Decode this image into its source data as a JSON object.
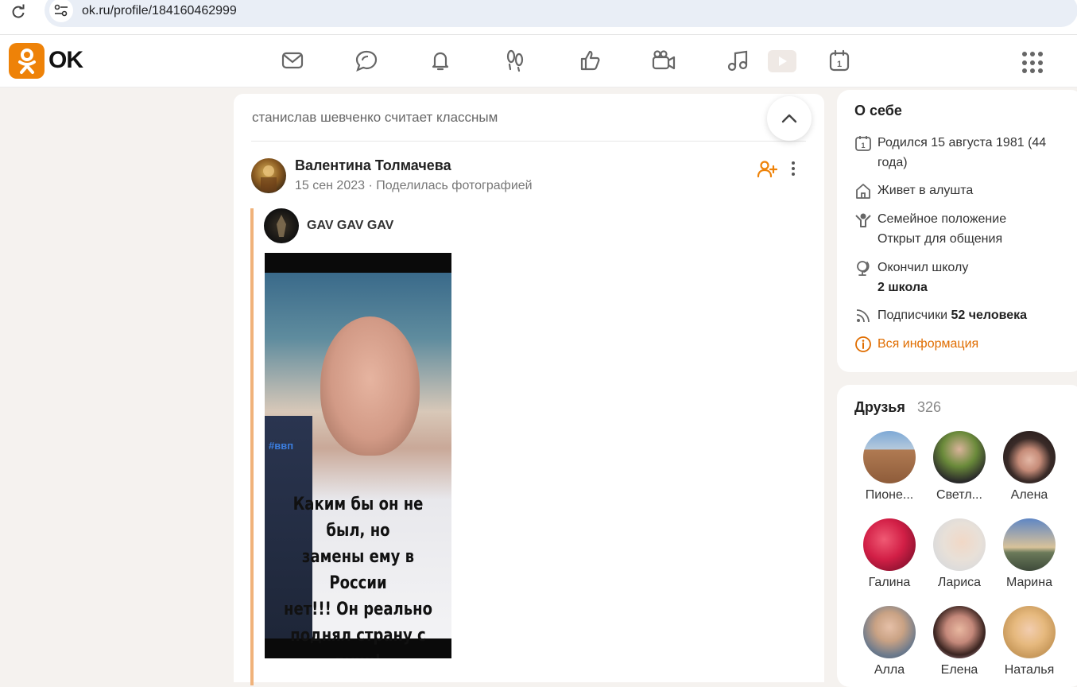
{
  "browser": {
    "url": "ok.ru/profile/184160462999"
  },
  "header": {
    "logo_text": "OK",
    "brand_color": "#ee8208",
    "nav_icons": [
      "messages-icon",
      "discussions-icon",
      "notifications-icon",
      "guests-icon",
      "reactions-icon",
      "video-icon",
      "music-icon",
      "video-player-icon",
      "calendar-icon"
    ]
  },
  "feed": {
    "liked_by": "станислав шевченко считает классным",
    "post": {
      "author": "Валентина Толмачева",
      "date": "15 сен 2023",
      "separator": "·",
      "action": "Поделилась фотографией",
      "repost": {
        "group_name": "GAV GAV GAV",
        "photo_hashtag": "#ввп",
        "photo_caption": "Каким бы он не был, но\nзамены ему в России\nнет!!! Он реально\nподнял страну с руин!"
      }
    }
  },
  "about": {
    "title": "О себе",
    "birth": "Родился 15 августа 1981 (44 года)",
    "lives": "Живет в алушта",
    "family_label": "Семейное положение",
    "family_value": "Открыт для общения",
    "school_label": "Окончил школу",
    "school_value": "2 школа",
    "subscribers_label": "Подписчики",
    "subscribers_value": "52 человека",
    "all_info": "Вся информация",
    "link_color": "#e06d00"
  },
  "friends": {
    "title": "Друзья",
    "count": "326",
    "items": [
      {
        "name": "Пионе..."
      },
      {
        "name": "Светл..."
      },
      {
        "name": "Алена"
      },
      {
        "name": "Галина"
      },
      {
        "name": "Лариса"
      },
      {
        "name": "Марина"
      },
      {
        "name": "Алла"
      },
      {
        "name": "Елена"
      },
      {
        "name": "Наталья"
      }
    ]
  }
}
